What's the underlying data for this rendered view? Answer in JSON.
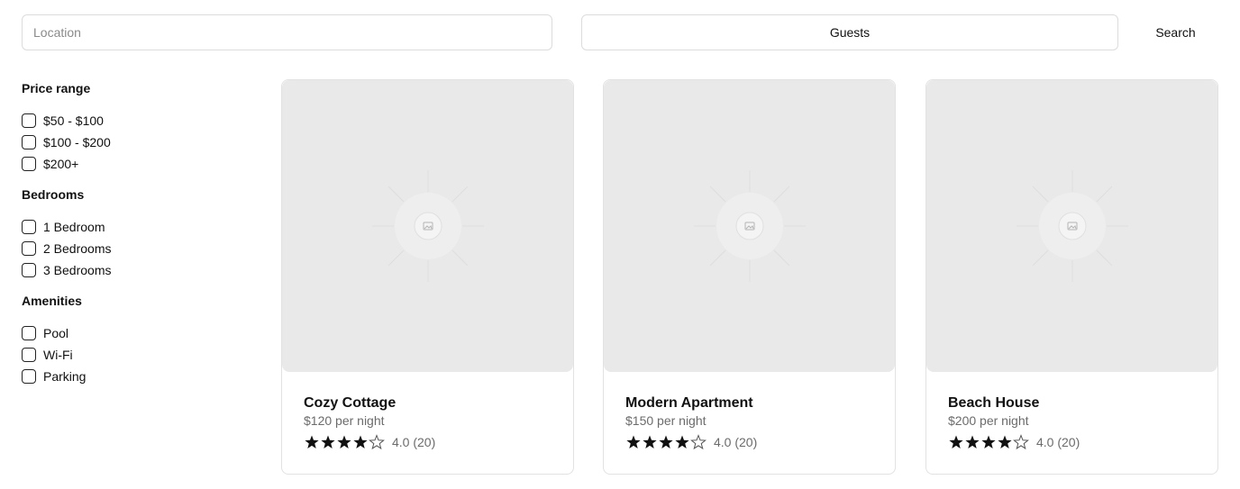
{
  "search": {
    "location_placeholder": "Location",
    "guests_label": "Guests",
    "search_label": "Search"
  },
  "filters": {
    "price": {
      "title": "Price range",
      "options": [
        "$50 - $100",
        "$100 - $200",
        "$200+"
      ]
    },
    "bedrooms": {
      "title": "Bedrooms",
      "options": [
        "1 Bedroom",
        "2 Bedrooms",
        "3 Bedrooms"
      ]
    },
    "amenities": {
      "title": "Amenities",
      "options": [
        "Pool",
        "Wi-Fi",
        "Parking"
      ]
    }
  },
  "listings": [
    {
      "title": "Cozy Cottage",
      "price": "$120 per night",
      "rating": 4,
      "rating_text": "4.0 (20)"
    },
    {
      "title": "Modern Apartment",
      "price": "$150 per night",
      "rating": 4,
      "rating_text": "4.0 (20)"
    },
    {
      "title": "Beach House",
      "price": "$200 per night",
      "rating": 4,
      "rating_text": "4.0 (20)"
    }
  ],
  "colors": {
    "star_filled": "#111111",
    "star_empty_stroke": "#555555",
    "image_placeholder": "#e9e9e9"
  },
  "icons": {
    "image_placeholder": "image-placeholder-icon",
    "star": "star-icon"
  }
}
